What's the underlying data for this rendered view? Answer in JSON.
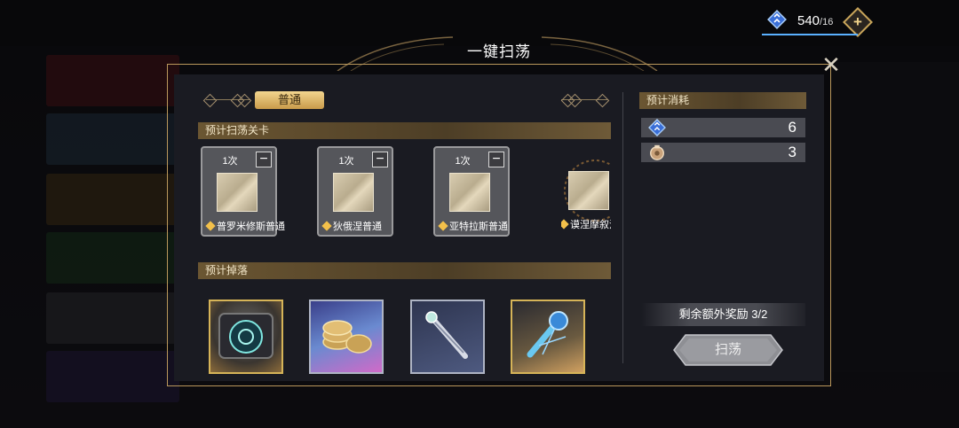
{
  "currency": {
    "value": "540",
    "max": "/16",
    "icon": "stamina-icon",
    "add_icon": "plus-icon"
  },
  "dialog": {
    "title": "一键扫荡",
    "tab_label": "普通",
    "stages_header": "预计扫荡关卡",
    "drops_header": "预计掉落",
    "cost_header": "预计消耗",
    "stages": [
      {
        "count": "1次",
        "name": "普罗米修斯普通"
      },
      {
        "count": "1次",
        "name": "狄俄涅普通"
      },
      {
        "count": "1次",
        "name": "亚特拉斯普通"
      },
      {
        "count": "",
        "name": "谟涅摩叙涅"
      }
    ],
    "drops": [
      {
        "icon": "disc-material-icon",
        "rarity": "gold"
      },
      {
        "icon": "coins-icon",
        "rarity": "purple"
      },
      {
        "icon": "wrench-material-icon",
        "rarity": "silver"
      },
      {
        "icon": "blue-crystal-material-icon",
        "rarity": "gold"
      }
    ],
    "costs": [
      {
        "icon": "stamina-icon",
        "value": "6"
      },
      {
        "icon": "sweep-ticket-icon",
        "value": "3"
      }
    ],
    "bonus_text": "剩余额外奖励  3/2",
    "sweep_button": "扫荡",
    "close_icon": "close-icon"
  },
  "colors": {
    "accent_gold": "#d6b458",
    "panel": "#1a1b22",
    "stamina_blue": "#5ab0ff"
  }
}
